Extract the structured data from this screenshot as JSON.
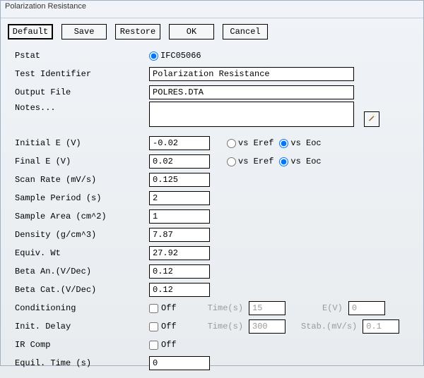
{
  "window": {
    "title": "Polarization Resistance"
  },
  "toolbar": {
    "default": "Default",
    "save": "Save",
    "restore": "Restore",
    "ok": "OK",
    "cancel": "Cancel"
  },
  "labels": {
    "pstat": "Pstat",
    "test_identifier": "Test Identifier",
    "output_file": "Output File",
    "notes": "Notes...",
    "initial_e": "Initial E (V)",
    "final_e": "Final E (V)",
    "scan_rate": "Scan Rate (mV/s)",
    "sample_period": "Sample Period (s)",
    "sample_area": "Sample Area (cm^2)",
    "density": "Density (g/cm^3)",
    "equiv_wt": "Equiv. Wt",
    "beta_an": "Beta An.(V/Dec)",
    "beta_cat": "Beta Cat.(V/Dec)",
    "conditioning": "Conditioning",
    "init_delay": "Init. Delay",
    "ir_comp": "IR Comp",
    "equil_time": "Equil. Time (s)"
  },
  "pstat": {
    "option": "IFC05066",
    "selected": true
  },
  "fields": {
    "test_identifier": "Polarization Resistance",
    "output_file": "POLRES.DTA",
    "notes": "",
    "initial_e": "-0.02",
    "final_e": "0.02",
    "scan_rate": "0.125",
    "sample_period": "2",
    "sample_area": "1",
    "density": "7.87",
    "equiv_wt": "27.92",
    "beta_an": "0.12",
    "beta_cat": "0.12",
    "equil_time": "0"
  },
  "ref_options": {
    "vs_eref": "vs Eref",
    "vs_eoc": "vs Eoc"
  },
  "check": {
    "off": "Off"
  },
  "cond": {
    "time_label": "Time(s)",
    "time_value": "15",
    "ev_label": "E(V)",
    "ev_value": "0"
  },
  "init_delay": {
    "time_label": "Time(s)",
    "time_value": "300",
    "stab_label": "Stab.(mV/s)",
    "stab_value": "0.1"
  }
}
